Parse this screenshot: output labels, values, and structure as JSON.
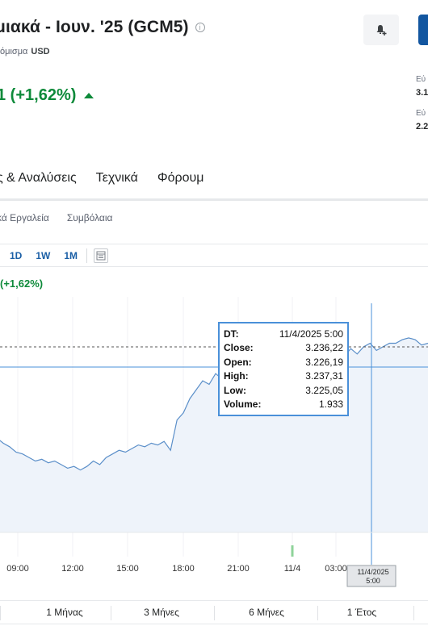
{
  "header": {
    "title": "μιακά - Ιουν. '25 (GCM5)",
    "currency_label": "όμισμα",
    "currency_value": "USD",
    "change": "1 (+1,62%)"
  },
  "side_stats": [
    {
      "label": "Εύ",
      "value": "3.1"
    },
    {
      "label": "Εύ",
      "value": "2.2"
    }
  ],
  "tabs": [
    "ς & Αναλύσεις",
    "Τεχνικά",
    "Φόρουμ"
  ],
  "subtabs": [
    "κά Εργαλεία",
    "Συμβόλαια"
  ],
  "periods": [
    "1D",
    "1W",
    "1M"
  ],
  "chart_change": "(+1,62%)",
  "tooltip": {
    "rows": [
      {
        "label": "DT:",
        "value": "11/4/2025 5:00"
      },
      {
        "label": "Close:",
        "value": "3.236,22"
      },
      {
        "label": "Open:",
        "value": "3.226,19"
      },
      {
        "label": "High:",
        "value": "3.237,31"
      },
      {
        "label": "Low:",
        "value": "3.225,05"
      },
      {
        "label": "Volume:",
        "value": "1.933"
      }
    ]
  },
  "crosshair_label": {
    "date": "11/4/2025",
    "time": "5:00"
  },
  "ranges": [
    "1 Μήνας",
    "3 Μήνες",
    "6 Μήνες",
    "1 Έτος"
  ],
  "colors": {
    "positive": "#0e8a3a",
    "link": "#1a5fa6",
    "line": "#5b8fc9",
    "area": "#eef3fa",
    "crosshair": "#4a90d9",
    "volume": "#8fd39a"
  },
  "chart_data": {
    "type": "area",
    "x_ticks": [
      "09:00",
      "12:00",
      "15:00",
      "18:00",
      "21:00",
      "11/4",
      "03:00"
    ],
    "series": [
      {
        "values": [
          3183,
          3180,
          3178,
          3175,
          3174,
          3172,
          3170,
          3171,
          3169,
          3170,
          3168,
          3166,
          3167,
          3165,
          3167,
          3170,
          3168,
          3172,
          3174,
          3176,
          3175,
          3177,
          3179,
          3178,
          3180,
          3179,
          3181,
          3176,
          3193,
          3197,
          3205,
          3210,
          3215,
          3213,
          3219,
          3216,
          3216,
          3212,
          3215,
          3218,
          3214,
          3222,
          3219,
          3224,
          3226,
          3222,
          3227,
          3224,
          3229,
          3225,
          3230,
          3231,
          3227,
          3232,
          3229,
          3233,
          3230,
          3234,
          3236,
          3232,
          3234,
          3236,
          3236,
          3238,
          3239,
          3238,
          3235,
          3236
        ]
      }
    ],
    "reference_level": 3234,
    "volume": [
      0,
      0,
      0,
      0,
      0,
      0,
      0,
      0,
      0,
      0,
      0,
      0,
      0,
      0,
      0,
      0,
      0,
      0,
      0,
      0,
      0,
      0,
      0,
      0,
      0,
      0,
      0,
      0,
      0,
      0,
      0,
      0,
      0,
      0,
      0,
      0,
      0,
      0,
      0,
      0,
      0,
      0,
      0,
      0,
      0,
      0,
      0,
      0,
      0,
      0,
      0,
      0,
      0,
      0,
      1933,
      0,
      0,
      0,
      0,
      0,
      0,
      0,
      0,
      0,
      0,
      0,
      0,
      0
    ]
  }
}
